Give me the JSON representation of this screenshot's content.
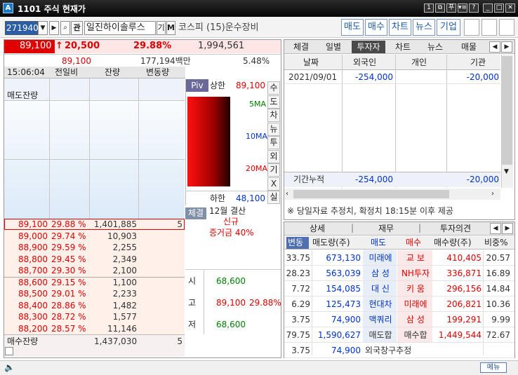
{
  "window": {
    "title": "1101 주식 현재가",
    "buttons": [
      "1",
      "⧉",
      "푸",
      "▾≡",
      "?",
      "_",
      "□",
      "✕"
    ]
  },
  "toolbar": {
    "code": "271940",
    "search_icon": "magnifier-icon",
    "kwan": "관",
    "stock_name": "일진하이솔루스",
    "gi": "기",
    "m": "M",
    "market": "코스피 (15)운수장비",
    "nav": [
      "매도",
      "매수",
      "차트",
      "뉴스",
      "기업"
    ]
  },
  "summary": {
    "price": "89,100",
    "change": "20,500",
    "change_rate": "29.88%",
    "volume": "1,994,561",
    "ref_price": "89,100",
    "amount": "177,194백만",
    "turnover": "5.48%",
    "time": "15:06:04",
    "col_prev": "전일비",
    "col_remain": "잔량",
    "col_delta": "변동량",
    "colors": {
      "up": "#e00000",
      "down": "#0033cc"
    }
  },
  "orderbook": {
    "ask_label": "매도잔량",
    "bid_label": "매수잔량",
    "asks": [],
    "bids": [
      {
        "price": "89,100",
        "rate": "29.88 %",
        "qty": "1,401,885",
        "chg": "5"
      },
      {
        "price": "89,000",
        "rate": "29.74 %",
        "qty": "10,903",
        "chg": ""
      },
      {
        "price": "88,900",
        "rate": "29.59 %",
        "qty": "2,255",
        "chg": ""
      },
      {
        "price": "88,800",
        "rate": "29.45 %",
        "qty": "2,349",
        "chg": ""
      },
      {
        "price": "88,700",
        "rate": "29.30 %",
        "qty": "2,100",
        "chg": ""
      },
      {
        "price": "88,600",
        "rate": "29.15 %",
        "qty": "1,100",
        "chg": ""
      },
      {
        "price": "88,500",
        "rate": "29.01 %",
        "qty": "2,233",
        "chg": ""
      },
      {
        "price": "88,400",
        "rate": "28.86 %",
        "qty": "1,482",
        "chg": ""
      },
      {
        "price": "88,300",
        "rate": "28.72 %",
        "qty": "1,577",
        "chg": ""
      },
      {
        "price": "88,200",
        "rate": "28.57 %",
        "qty": "11,146",
        "chg": ""
      }
    ],
    "total_bid": "1,437,030",
    "total_bid_chg": "5"
  },
  "pivot": {
    "label": "Piv",
    "upper_label": "상한",
    "upper": "89,100",
    "ma5": "5MA",
    "ma10": "10MA",
    "ma20": "20MA",
    "lower_label": "하한",
    "lower": "48,100"
  },
  "side_tabs": [
    "수",
    "도",
    "차",
    "뉴",
    "투",
    "외",
    "기",
    "X",
    "실"
  ],
  "info": {
    "tab": "체결",
    "settle": "12월 결산",
    "new": "신규",
    "margin": "증거금 40%"
  },
  "ohlc": [
    {
      "label": "시",
      "value": "68,600",
      "rate": ""
    },
    {
      "label": "고",
      "value": "89,100",
      "rate": "29.88%"
    },
    {
      "label": "저",
      "value": "68,600",
      "rate": ""
    }
  ],
  "investor": {
    "tabs": [
      "체결",
      "일별",
      "투자자",
      "차트",
      "뉴스",
      "매물"
    ],
    "headers": [
      "날짜",
      "외국인",
      "개인",
      "기관"
    ],
    "row": {
      "date": "2021/09/01",
      "foreign": "-254,000",
      "personal": "",
      "inst": "-20,000"
    },
    "total": {
      "label": "기간누적",
      "foreign": "-254,000",
      "personal": "",
      "inst": "-20,000"
    },
    "note": "※ 당일자료 추정치, 확정치 18:15분 이후 제공"
  },
  "broker": {
    "tabs": [
      "상세",
      "재무",
      "투자의견"
    ],
    "headers": [
      "변동",
      "매도량(주)",
      "매도",
      "매수",
      "매수량(주)",
      "비중%"
    ],
    "rows": [
      {
        "chg": "33.75",
        "sell_qty": "673,130",
        "seller": "미래에",
        "buyer": "교  보",
        "buy_qty": "410,405",
        "pct": "20.57"
      },
      {
        "chg": "28.23",
        "sell_qty": "563,039",
        "seller": "삼  성",
        "buyer": "NH투자",
        "buy_qty": "336,871",
        "pct": "16.89"
      },
      {
        "chg": "7.72",
        "sell_qty": "154,085",
        "seller": "대  신",
        "buyer": "키  움",
        "buy_qty": "296,156",
        "pct": "14.84"
      },
      {
        "chg": "6.29",
        "sell_qty": "125,473",
        "seller": "현대차",
        "buyer": "미래에",
        "buy_qty": "206,821",
        "pct": "10.36"
      },
      {
        "chg": "3.75",
        "sell_qty": "74,900",
        "seller": "맥쿼리",
        "buyer": "삼  성",
        "buy_qty": "199,291",
        "pct": "9.99"
      }
    ],
    "sum": {
      "chg": "79.75",
      "sell_qty": "1,590,627",
      "seller": "매도합",
      "buyer": "매수합",
      "buy_qty": "1,449,544",
      "pct": "72.67"
    },
    "foreign": {
      "chg": "3.75",
      "sell_qty": "74,900",
      "label": "외국창구추정"
    }
  },
  "status": {
    "menu": "메뉴"
  }
}
